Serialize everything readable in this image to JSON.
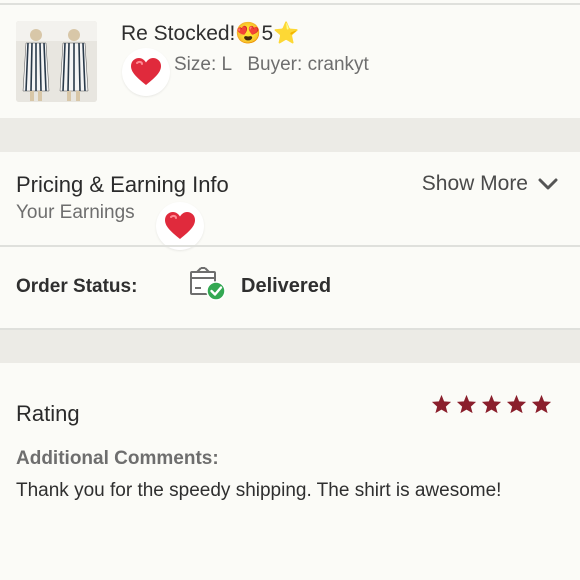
{
  "listing": {
    "title": "Re Stocked!😍5⭐",
    "size": "Size: L",
    "buyer": "Buyer: crankyt"
  },
  "pricing": {
    "heading": "Pricing & Earning Info",
    "show_more": "Show More",
    "earnings_label": "Your Earnings"
  },
  "order": {
    "status_label": "Order Status:",
    "status_value": "Delivered"
  },
  "rating": {
    "label": "Rating",
    "stars": 5,
    "star_color": "#8a1f2c",
    "comments_label": "Additional Comments:",
    "comment": "Thank you for the speedy shipping. The shirt is awesome!"
  },
  "colors": {
    "heart": "#e02a3c",
    "check": "#34a853"
  }
}
